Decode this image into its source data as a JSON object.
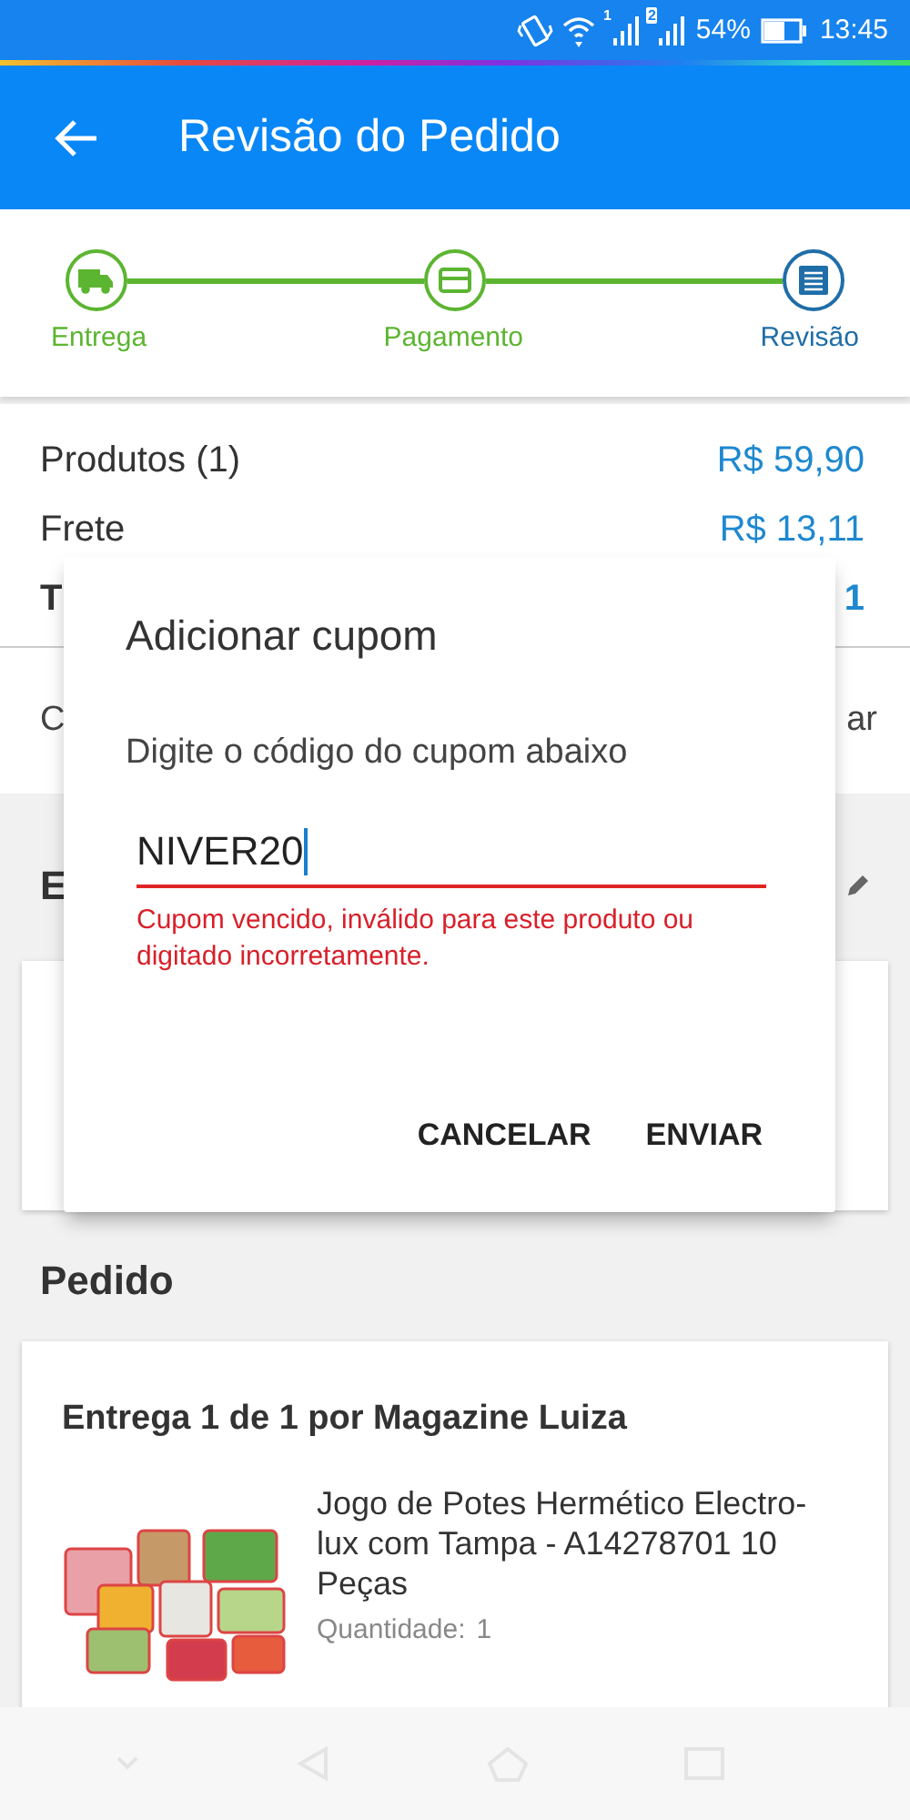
{
  "status_bar": {
    "sim_1": "1",
    "sim_2": "2",
    "battery": "54%",
    "time": "13:45"
  },
  "app_bar": {
    "title": "Revisão do Pedido"
  },
  "steps": [
    {
      "label": "Entrega",
      "kind": "truck",
      "current": false
    },
    {
      "label": "Pagamento",
      "kind": "card",
      "current": false
    },
    {
      "label": "Revisão",
      "kind": "list",
      "current": true
    }
  ],
  "summary": [
    {
      "label": "Produtos (1)",
      "value": "R$ 59,90",
      "kind": "line"
    },
    {
      "label": "Frete",
      "value": "R$ 13,11",
      "kind": "line"
    },
    {
      "label": "T",
      "value": "1",
      "kind": "total"
    }
  ],
  "coupon_row": {
    "label": "C",
    "action": "ar"
  },
  "address_heading": "E",
  "order": {
    "heading": "Pedido",
    "card_title": "Entrega 1 de 1 por Magazine Luiza",
    "product": {
      "name": "Jogo de Potes Hermético Electro-lux com Tampa - A14278701 10 Peças",
      "quantity_label": "Quantidade:",
      "quantity": "1"
    }
  },
  "dialog": {
    "title": "Adicionar cupom",
    "message": "Digite o código do cupom abaixo",
    "field": {
      "value": "NIVER20",
      "error": true
    },
    "error_message": "Cupom vencido, inválido para este produto ou digitado incorretamente.",
    "buttons": [
      "CANCELAR",
      "ENVIAR"
    ]
  }
}
